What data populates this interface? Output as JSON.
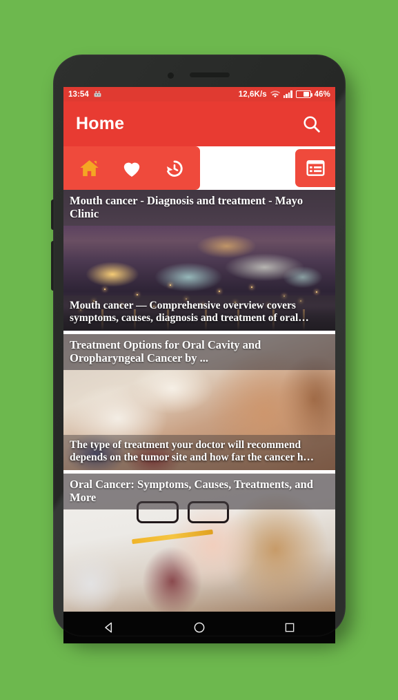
{
  "background_color": "#6db84e",
  "device": {
    "frame_color": "#2b2d2b",
    "earpiece": "earpiece-speaker",
    "camera": "front-camera"
  },
  "status_bar": {
    "time": "13:54",
    "notification_icon": "android-notification-icon",
    "network_speed": "12,6K/s",
    "wifi_icon": "wifi-icon",
    "signal_icon": "signal-bars-icon",
    "battery_icon": "battery-icon",
    "battery_level": "46%",
    "background_color": "#e03a31"
  },
  "app_bar": {
    "title": "Home",
    "search_icon": "search-icon",
    "background_color": "#e83b32"
  },
  "tabs": {
    "items": [
      {
        "id": "home",
        "icon": "home-icon",
        "label": "Home",
        "active": true,
        "color": "#f5a623"
      },
      {
        "id": "favorites",
        "icon": "heart-icon",
        "label": "Favorites",
        "active": false,
        "color": "#ffffff"
      },
      {
        "id": "history",
        "icon": "history-icon",
        "label": "History",
        "active": false,
        "color": "#ffffff"
      }
    ],
    "menu_button": {
      "icon": "list-menu-icon",
      "label": "Menu"
    },
    "group_color": "#ef4a3c"
  },
  "feed": {
    "cards": [
      {
        "title": "Mouth cancer - Diagnosis and treatment - Mayo Clinic",
        "description": "Mouth cancer — Comprehensive overview covers symptoms, causes, diagnosis and treatment of oral…",
        "image": "prague-night-skyline-photo"
      },
      {
        "title": "Treatment Options for Oral Cavity and Oropharyngeal Cancer by ...",
        "description": "The type of treatment your doctor will recommend depends on the tumor site and how far the cancer h…",
        "image": "woman-studying-with-books-photo"
      },
      {
        "title": "Oral Cancer: Symptoms, Causes, Treatments, and More",
        "description": "",
        "image": "woman-with-glasses-biting-pencil-photo"
      }
    ]
  },
  "nav_bar": {
    "back": "back-triangle-icon",
    "home": "home-circle-icon",
    "recents": "recents-square-icon",
    "background_color": "#050505"
  }
}
